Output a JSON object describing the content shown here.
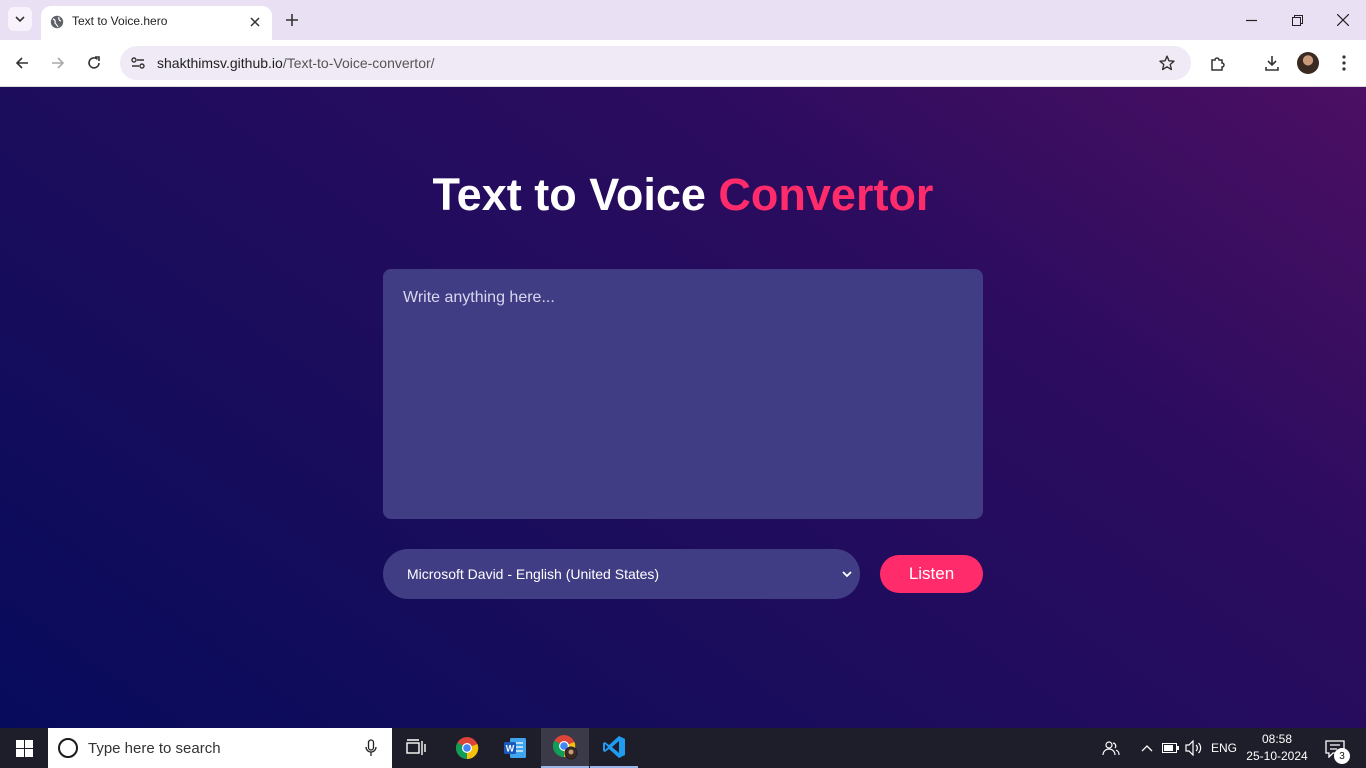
{
  "browser": {
    "tab": {
      "title": "Text to Voice.hero"
    },
    "url": {
      "host": "shakthimsv.github.io",
      "path": "/Text-to-Voice-convertor/"
    }
  },
  "page": {
    "title_main": "Text to Voice ",
    "title_accent": "Convertor",
    "textarea_placeholder": "Write anything here...",
    "voice_select": {
      "selected": "Microsoft David - English (United States)"
    },
    "listen_button": "Listen",
    "colors": {
      "accent": "#ff2b6b",
      "panel": "#403d84",
      "bg_start": "#070b5c",
      "bg_end": "#4c0f63"
    }
  },
  "taskbar": {
    "search_placeholder": "Type here to search",
    "language": "ENG",
    "time": "08:58",
    "date": "25-10-2024",
    "notification_count": "3",
    "apps": [
      "windows-start",
      "task-view",
      "chrome",
      "word",
      "chrome-profile",
      "vscode"
    ]
  }
}
